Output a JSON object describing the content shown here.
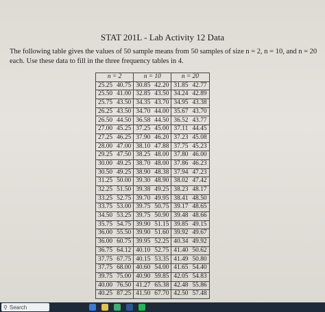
{
  "document": {
    "title": "STAT 201L - Lab Activity 12 Data",
    "intro": "The following table gives the values of 50 sample means from 50 samples of size n = 2, n = 10, and n = 20 each. Use these data to fill in the three frequency tables in 4."
  },
  "table": {
    "headers": [
      "n = 2",
      "n = 10",
      "n = 20"
    ],
    "rows": [
      [
        "25.25",
        "40.75",
        "30.85",
        "42.20",
        "31.85",
        "42.77"
      ],
      [
        "25.50",
        "41.00",
        "32.85",
        "43.50",
        "34.24",
        "42.89"
      ],
      [
        "25.75",
        "43.50",
        "34.35",
        "43.70",
        "34.95",
        "43.38"
      ],
      [
        "26.25",
        "43.50",
        "34.70",
        "44.00",
        "35.67",
        "43.70"
      ],
      [
        "26.50",
        "44.50",
        "36.58",
        "44.50",
        "36.52",
        "43.77"
      ],
      [
        "27.00",
        "45.25",
        "37.25",
        "45.00",
        "37.11",
        "44.45"
      ],
      [
        "27.25",
        "46.25",
        "37.90",
        "46.20",
        "37.23",
        "45.08"
      ],
      [
        "28.00",
        "47.00",
        "38.10",
        "47.88",
        "37.75",
        "45.23"
      ],
      [
        "29.25",
        "47.50",
        "38.25",
        "48.00",
        "37.80",
        "46.00"
      ],
      [
        "30.00",
        "49.25",
        "38.70",
        "48.00",
        "37.86",
        "46.23"
      ],
      [
        "30.50",
        "49.25",
        "38.90",
        "48.38",
        "37.94",
        "47.23"
      ],
      [
        "31.25",
        "50.00",
        "39.30",
        "48.90",
        "38.02",
        "47.42"
      ],
      [
        "32.25",
        "51.50",
        "39.38",
        "49.25",
        "38.23",
        "48.17"
      ],
      [
        "33.25",
        "52.75",
        "39.70",
        "49.95",
        "38.41",
        "48.50"
      ],
      [
        "33.75",
        "53.00",
        "39.75",
        "50.75",
        "39.17",
        "48.65"
      ],
      [
        "34.50",
        "53.25",
        "39.75",
        "50.90",
        "39.48",
        "48.66"
      ],
      [
        "35.75",
        "54.75",
        "39.90",
        "51.15",
        "39.85",
        "49.15"
      ],
      [
        "36.00",
        "55.50",
        "39.90",
        "51.60",
        "39.92",
        "49.67"
      ],
      [
        "36.00",
        "60.75",
        "39.95",
        "52.25",
        "40.34",
        "49.92"
      ],
      [
        "36.75",
        "64.12",
        "40.10",
        "52.75",
        "41.40",
        "50.62"
      ],
      [
        "37.75",
        "67.75",
        "40.15",
        "53.35",
        "41.49",
        "50.80"
      ],
      [
        "37.75",
        "68.00",
        "40.60",
        "54.00",
        "41.65",
        "54.40"
      ],
      [
        "39.75",
        "75.00",
        "40.90",
        "59.85",
        "42.05",
        "54.83"
      ],
      [
        "40.00",
        "76.50",
        "41.27",
        "65.38",
        "42.48",
        "55.86"
      ],
      [
        "40.25",
        "87.25",
        "41.50",
        "67.70",
        "42.50",
        "57.48"
      ]
    ]
  },
  "taskbar": {
    "search_placeholder": "Search"
  },
  "colors": {
    "paper": "#e3e0da",
    "ink": "#1b1b1b",
    "taskbar": "#1e2a3a"
  }
}
